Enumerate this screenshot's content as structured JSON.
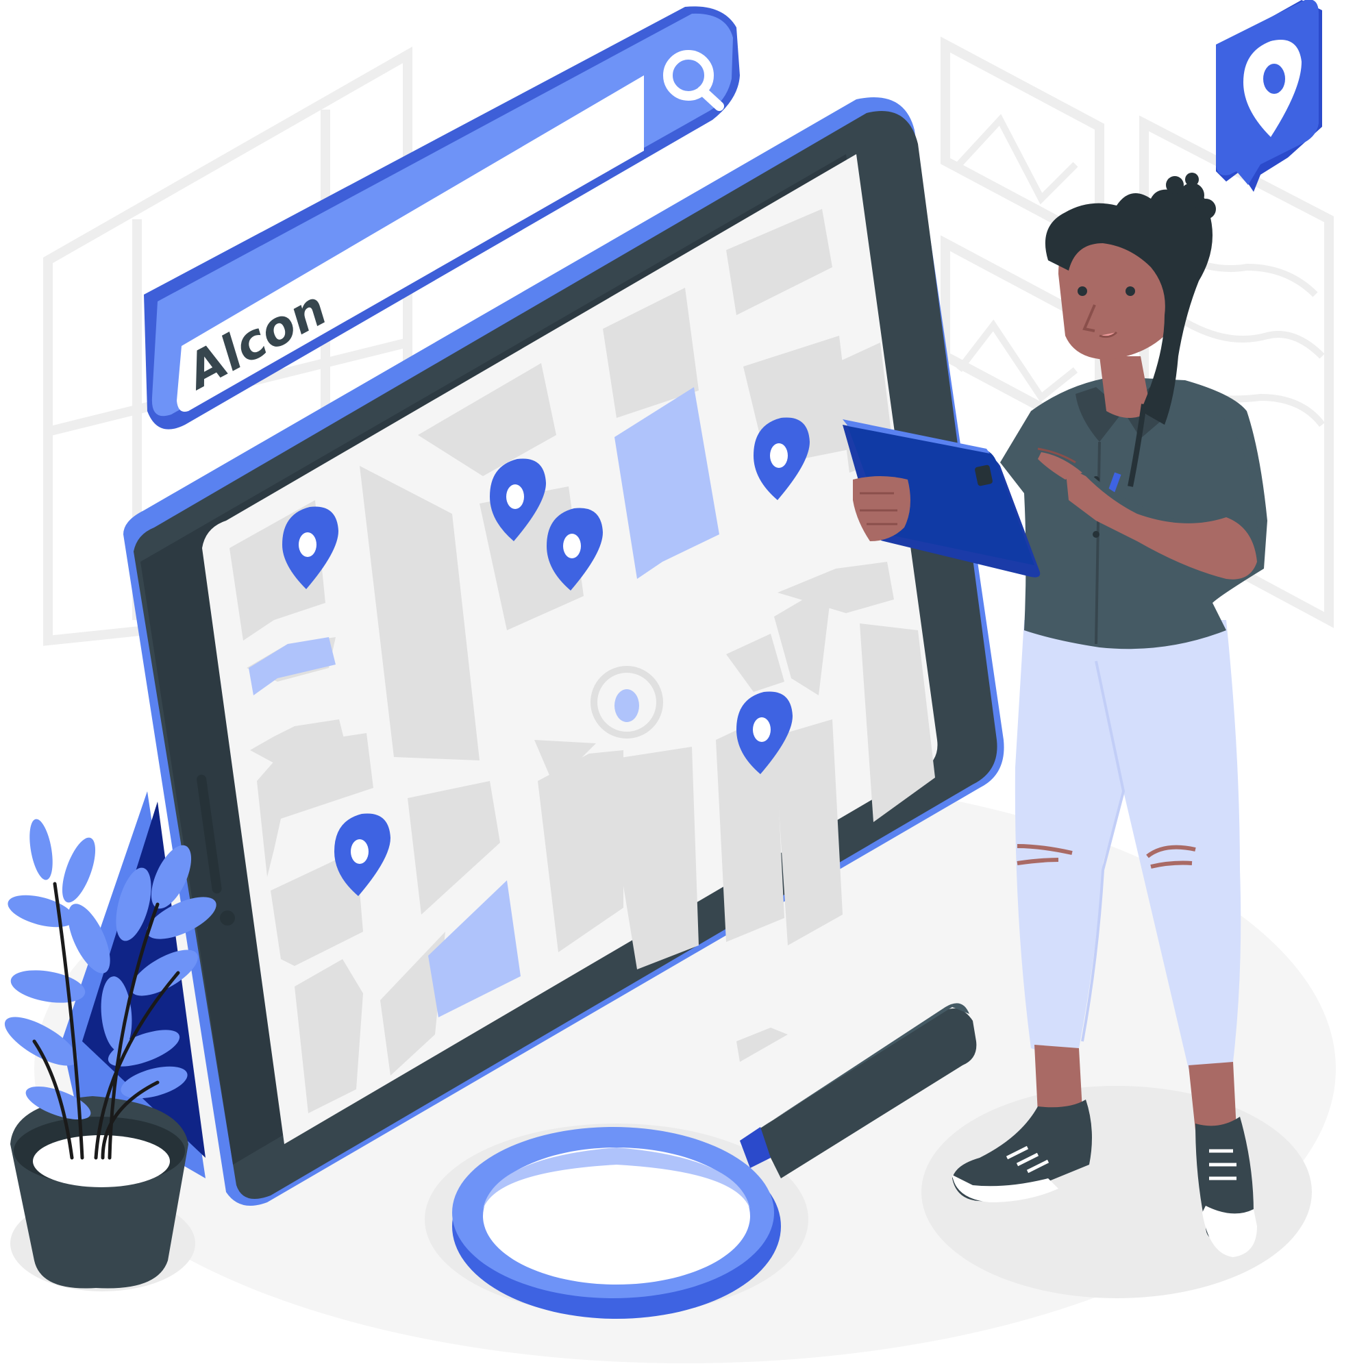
{
  "search_bar": {
    "query": "Alcon",
    "icon": "search-icon"
  },
  "floating_badge": {
    "icon": "map-pin-icon"
  },
  "map": {
    "pin_icon": "map-pin-icon",
    "pin_count": 7
  },
  "icons": {
    "magnifier": "magnifying-glass-icon",
    "tablet": "tablet-icon",
    "plant": "potted-plant-icon",
    "picture_frames": "image-frame-icon"
  },
  "colors": {
    "accent": "#5A82F0",
    "accent_dark": "#3E5FD8",
    "accent_light": "#AFC3FB",
    "device_dark": "#37464E",
    "map_block": "#E0E0E0",
    "map_road": "#F5F5F5",
    "skin": "#A96A65",
    "jeans": "#D4DEFC"
  }
}
